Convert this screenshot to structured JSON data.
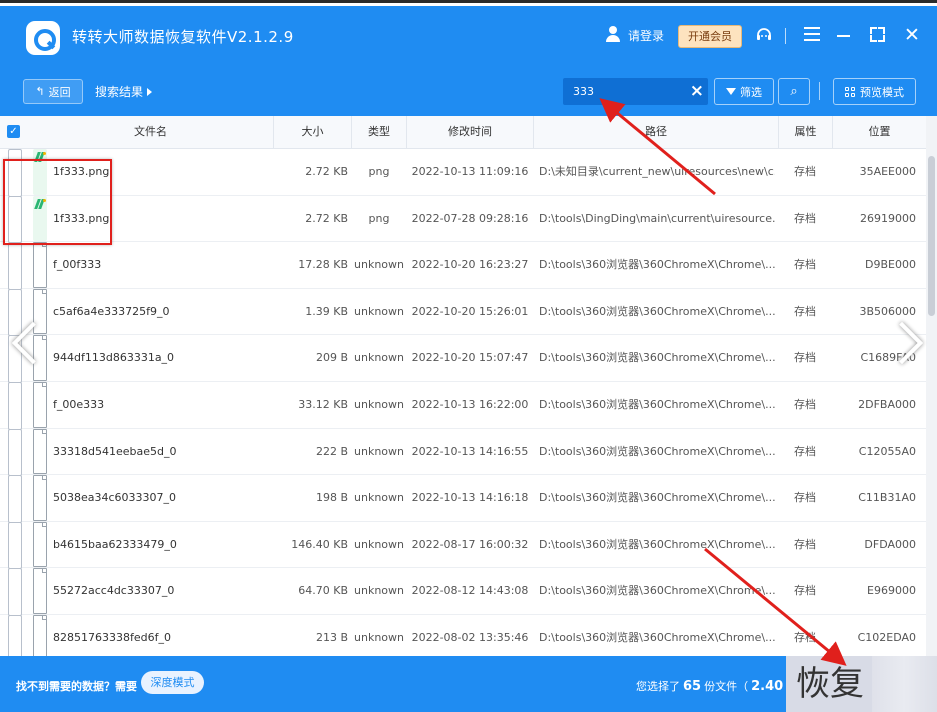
{
  "app": {
    "title": "转转大师数据恢复软件V2.1.2.9",
    "login_label": "请登录",
    "vip_label": "开通会员"
  },
  "toolbar": {
    "back_label": "返回",
    "breadcrumb": "搜索结果",
    "search_value": "333",
    "filter_label": "筛选",
    "preview_mode_label": "预览模式"
  },
  "table": {
    "headers": {
      "name": "文件名",
      "size": "大小",
      "type": "类型",
      "mtime": "修改时间",
      "path": "路径",
      "attr": "属性",
      "loc": "位置"
    },
    "rows": [
      {
        "icon": "png-icon",
        "name": "1f333.png",
        "size": "2.72 KB",
        "type": "png",
        "mtime": "2022-10-13 11:09:16",
        "path": "D:\\未知目录\\current_new\\uiresources\\new\\c...",
        "attr": "存档",
        "loc": "35AEE000"
      },
      {
        "icon": "png-icon",
        "name": "1f333.png",
        "size": "2.72 KB",
        "type": "png",
        "mtime": "2022-07-28 09:28:16",
        "path": "D:\\tools\\DingDing\\main\\current\\uiresource...",
        "attr": "存档",
        "loc": "26919000"
      },
      {
        "icon": "file-icon",
        "name": "f_00f333",
        "size": "17.28 KB",
        "type": "unknown",
        "mtime": "2022-10-20 16:23:27",
        "path": "D:\\tools\\360浏览器\\360ChromeX\\Chrome\\...",
        "attr": "存档",
        "loc": "D9BE000"
      },
      {
        "icon": "file-icon",
        "name": "c5af6a4e333725f9_0",
        "size": "1.39 KB",
        "type": "unknown",
        "mtime": "2022-10-20 15:26:01",
        "path": "D:\\tools\\360浏览器\\360ChromeX\\Chrome\\...",
        "attr": "存档",
        "loc": "3B506000"
      },
      {
        "icon": "file-icon",
        "name": "944df113d863331a_0",
        "size": "209 B",
        "type": "unknown",
        "mtime": "2022-10-20 15:07:47",
        "path": "D:\\tools\\360浏览器\\360ChromeX\\Chrome\\...",
        "attr": "存档",
        "loc": "C1689FA0"
      },
      {
        "icon": "file-icon",
        "name": "f_00e333",
        "size": "33.12 KB",
        "type": "unknown",
        "mtime": "2022-10-13 16:22:00",
        "path": "D:\\tools\\360浏览器\\360ChromeX\\Chrome\\...",
        "attr": "存档",
        "loc": "2DFBA000"
      },
      {
        "icon": "file-icon",
        "name": "33318d541eebae5d_0",
        "size": "222 B",
        "type": "unknown",
        "mtime": "2022-10-13 14:16:55",
        "path": "D:\\tools\\360浏览器\\360ChromeX\\Chrome\\...",
        "attr": "存档",
        "loc": "C12055A0"
      },
      {
        "icon": "file-icon",
        "name": "5038ea34c6033307_0",
        "size": "198 B",
        "type": "unknown",
        "mtime": "2022-10-13 14:16:18",
        "path": "D:\\tools\\360浏览器\\360ChromeX\\Chrome\\...",
        "attr": "存档",
        "loc": "C11B31A0"
      },
      {
        "icon": "file-icon",
        "name": "b4615baa62333479_0",
        "size": "146.40 KB",
        "type": "unknown",
        "mtime": "2022-08-17 16:00:32",
        "path": "D:\\tools\\360浏览器\\360ChromeX\\Chrome\\...",
        "attr": "存档",
        "loc": "DFDA000"
      },
      {
        "icon": "file-icon",
        "name": "55272acc4dc33307_0",
        "size": "64.70 KB",
        "type": "unknown",
        "mtime": "2022-08-12 14:43:08",
        "path": "D:\\tools\\360浏览器\\360ChromeX\\Chrome\\...",
        "attr": "存档",
        "loc": "E969000"
      },
      {
        "icon": "file-icon",
        "name": "82851763338fed6f_0",
        "size": "213 B",
        "type": "unknown",
        "mtime": "2022-08-02 13:35:46",
        "path": "D:\\tools\\360浏览器\\360ChromeX\\Chrome\\...",
        "attr": "存档",
        "loc": "C102EDA0"
      }
    ]
  },
  "footer": {
    "prompt": "找不到需要的数据？需要",
    "deep_mode_label": "深度模式",
    "selected_prefix": "您选择了",
    "selected_count": "65",
    "selected_suffix": "份文件（",
    "selected_size": "2.40",
    "recover_label": "恢复"
  },
  "colors": {
    "accent": "#1f8cf2",
    "annotation_red": "#e0201c"
  }
}
